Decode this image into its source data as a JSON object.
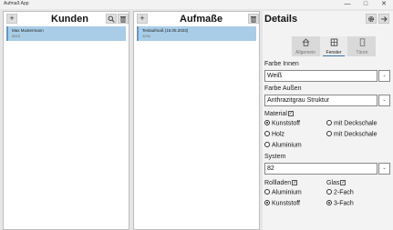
{
  "window": {
    "title": "Aufmaß App",
    "minimize_glyph": "—",
    "maximize_glyph": "□",
    "close_glyph": "✕"
  },
  "kunden": {
    "add_glyph": "+",
    "title": "Kunden",
    "search_icon": "search-icon",
    "delete_icon": "trash-icon",
    "items": [
      {
        "name": "Max Mustermann",
        "code": "0815"
      }
    ]
  },
  "aufmasse": {
    "add_glyph": "+",
    "title": "Aufmaße",
    "delete_icon": "trash-icon",
    "items": [
      {
        "name": "Testaufmaß (15.05.2023)",
        "code": "1234"
      }
    ]
  },
  "details": {
    "title": "Details",
    "settings_icon": "gear-icon",
    "forward_icon": "arrow-right-icon",
    "tabs": [
      {
        "label": "Allgemein",
        "icon": "house-icon",
        "active": false
      },
      {
        "label": "Fenster",
        "icon": "window-icon",
        "active": true
      },
      {
        "label": "Türen",
        "icon": "door-icon",
        "active": false
      }
    ],
    "farbe_innen": {
      "label": "Farbe Innen",
      "value": "Weiß"
    },
    "farbe_aussen": {
      "label": "Farbe Außen",
      "value": "Anthrazitgrau Struktur"
    },
    "material": {
      "label": "Material",
      "checked": true,
      "options": [
        "Kunststoff",
        "Holz",
        "Aluminium",
        "mit Deckschale",
        "mit Deckschale"
      ],
      "selected": "Kunststoff"
    },
    "system": {
      "label": "System",
      "value": "82"
    },
    "rollladen": {
      "label": "Rollladen",
      "checked": true,
      "options": [
        "Aluminium",
        "Kunststoff"
      ],
      "selected": "Kunststoff"
    },
    "glas": {
      "label": "Glas",
      "checked": true,
      "options": [
        "2-Fach",
        "3-Fach"
      ],
      "selected": "3-Fach"
    },
    "dropdown_glyph": "⌄"
  }
}
